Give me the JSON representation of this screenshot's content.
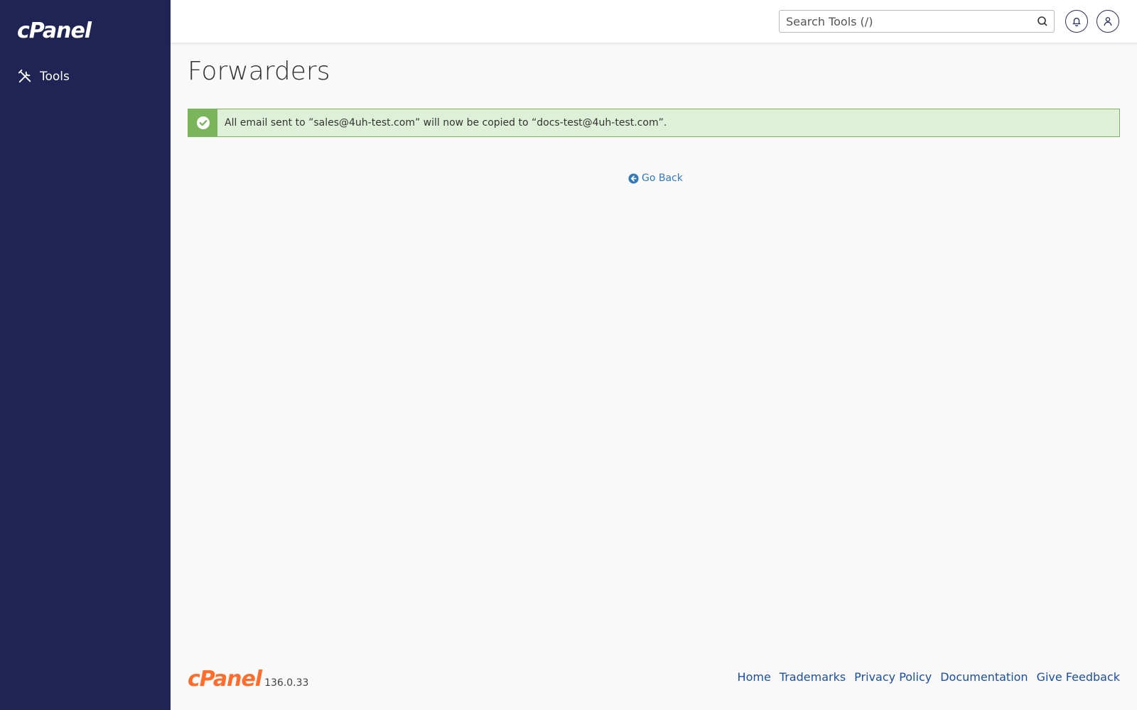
{
  "sidebar": {
    "brand": "cPanel",
    "items": [
      {
        "label": "Tools",
        "icon": "tools-icon"
      }
    ]
  },
  "header": {
    "search": {
      "placeholder": "Search Tools (/)",
      "value": ""
    },
    "notifications_icon": "bell-icon",
    "user_icon": "user-icon"
  },
  "main": {
    "title": "Forwarders",
    "alert": {
      "type": "success",
      "icon": "check-circle-icon",
      "message": "All email sent to ”sales@4uh-test.com” will now be copied to “docs-test@4uh-test.com”."
    },
    "go_back_label": "Go Back"
  },
  "footer": {
    "logo": "cPanel",
    "version": "136.0.33",
    "links": [
      "Home",
      "Trademarks",
      "Privacy Policy",
      "Documentation",
      "Give Feedback"
    ]
  },
  "colors": {
    "sidebar_bg": "#1f2454",
    "accent_orange": "#ff6c2c",
    "success_bg": "#dff0d8",
    "success_border": "#7ab55c",
    "link_blue": "#3279b7"
  }
}
